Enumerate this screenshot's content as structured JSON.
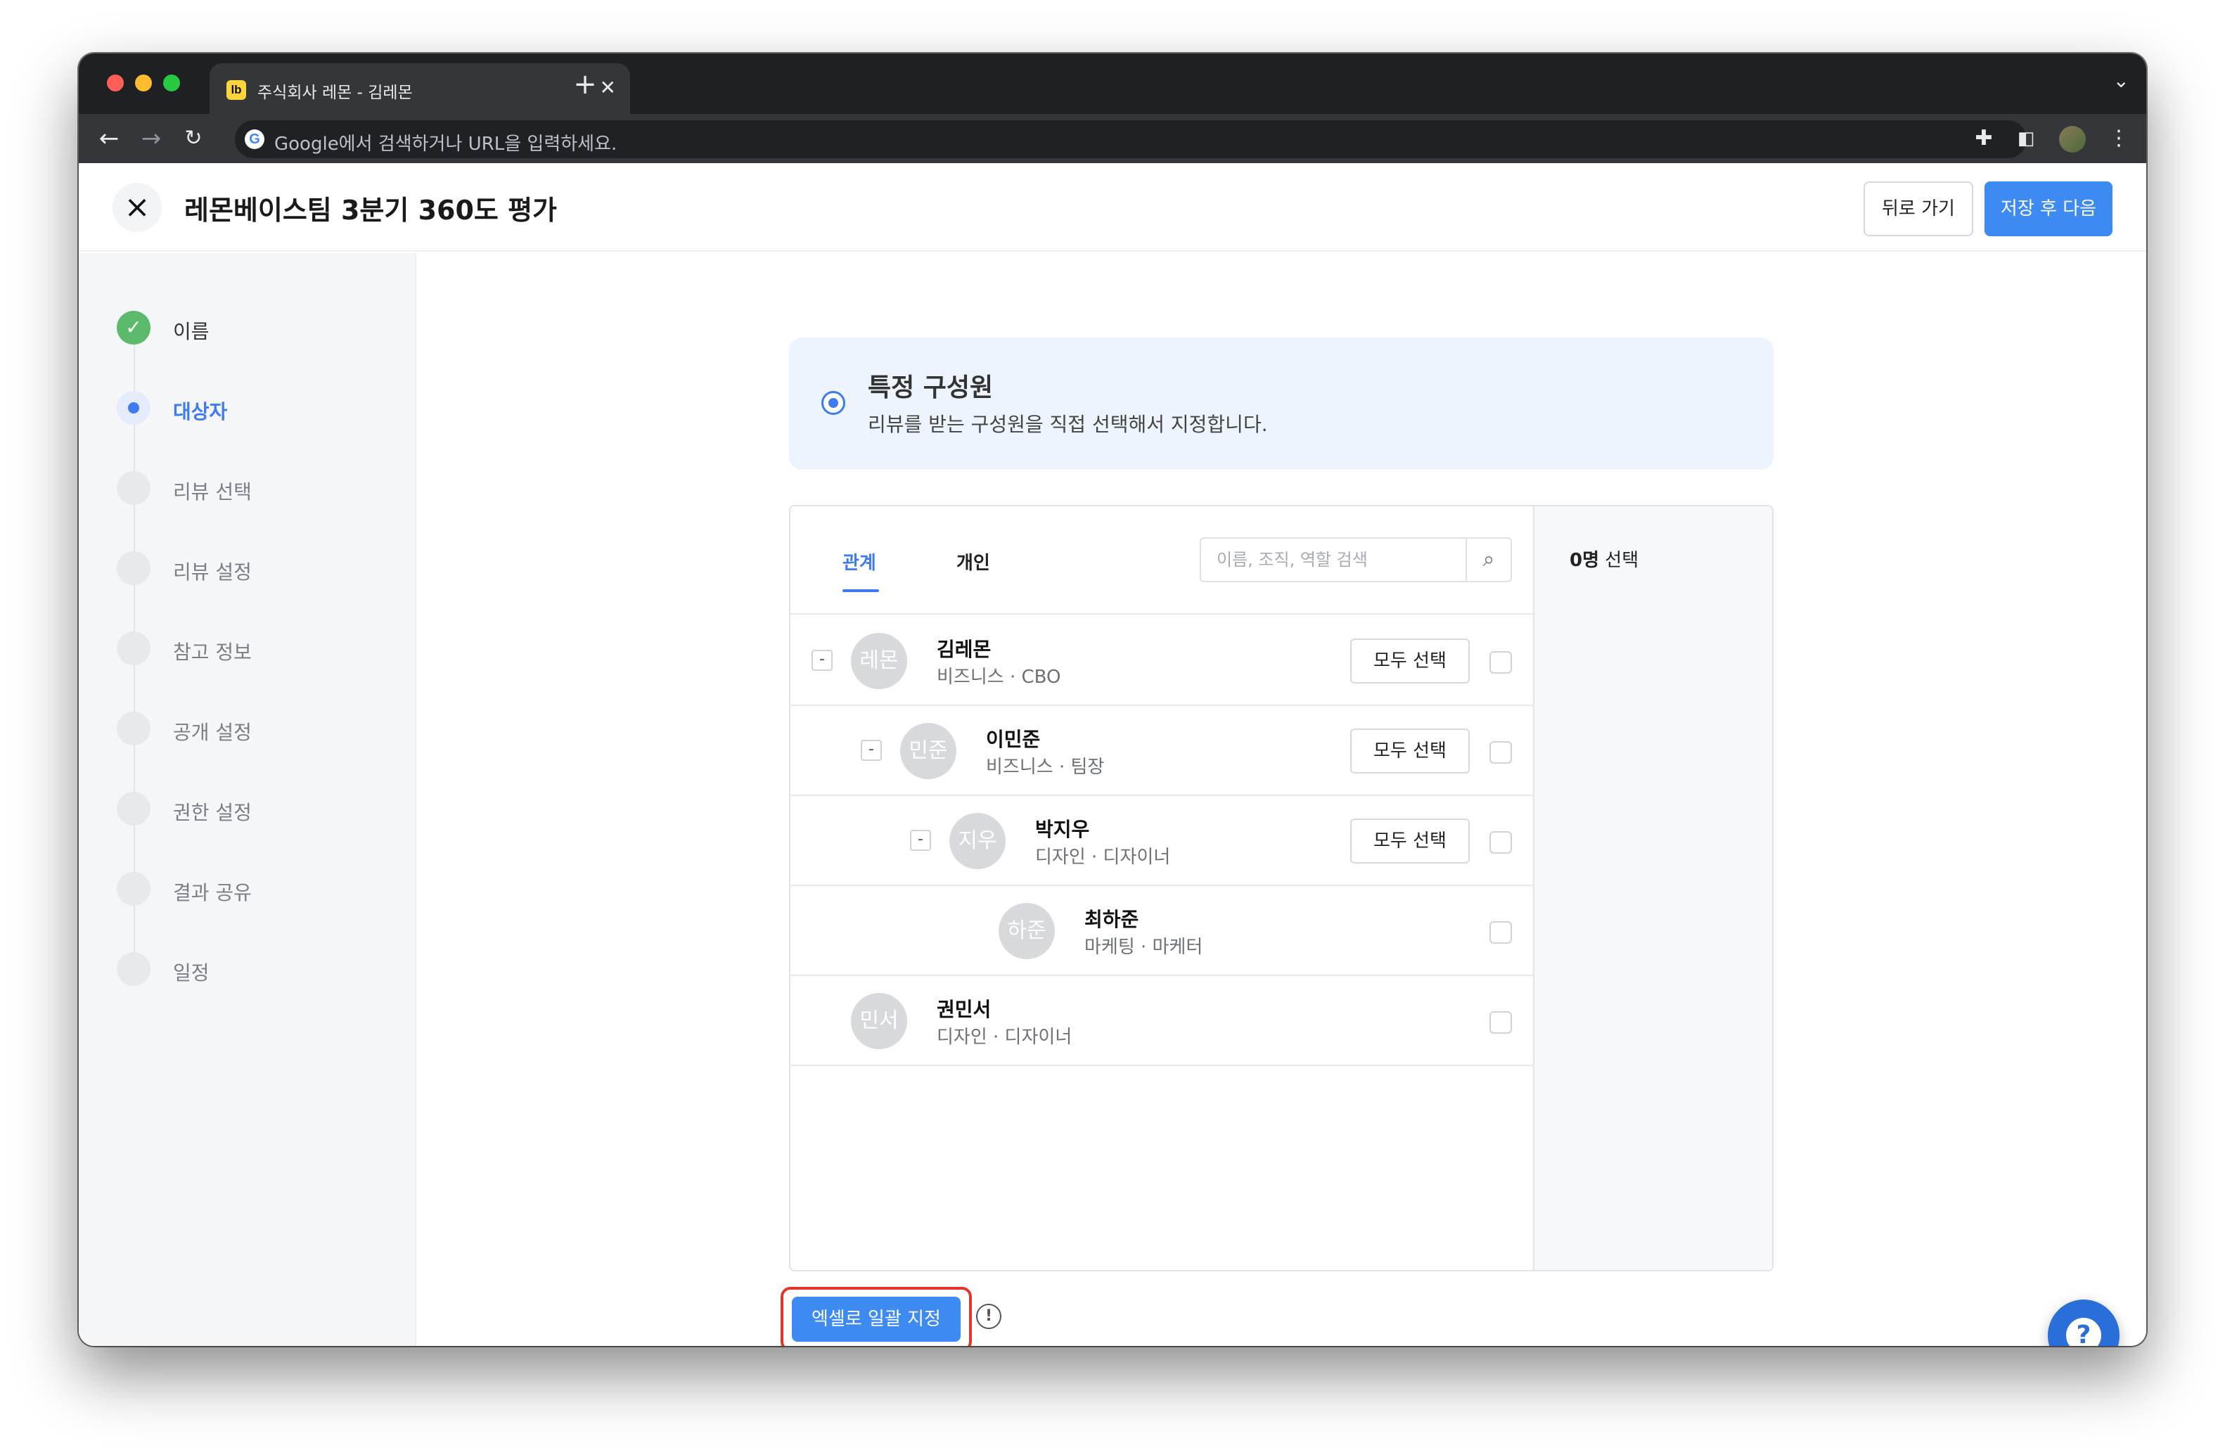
{
  "browser": {
    "tab_title": "주식회사 레몬 - 김레몬",
    "favicon_text": "lb",
    "new_tab_icon": "plus-icon",
    "omnibox_text": "Google에서 검색하거나 URL을 입력하세요."
  },
  "header": {
    "title": "레몬베이스팀 3분기 360도 평가",
    "back_label": "뒤로 가기",
    "save_label": "저장 후 다음"
  },
  "sidebar": {
    "steps": [
      {
        "label": "이름",
        "state": "done"
      },
      {
        "label": "대상자",
        "state": "active"
      },
      {
        "label": "리뷰 선택",
        "state": "pending"
      },
      {
        "label": "리뷰 설정",
        "state": "pending"
      },
      {
        "label": "참고 정보",
        "state": "pending"
      },
      {
        "label": "공개 설정",
        "state": "pending"
      },
      {
        "label": "권한 설정",
        "state": "pending"
      },
      {
        "label": "결과 공유",
        "state": "pending"
      },
      {
        "label": "일정",
        "state": "pending"
      }
    ]
  },
  "option": {
    "title": "특정 구성원",
    "description": "리뷰를 받는 구성원을 직접 선택해서 지정합니다."
  },
  "picker": {
    "tabs": [
      "관계",
      "개인"
    ],
    "search_placeholder": "이름, 조직, 역할 검색",
    "selected_count": "0명",
    "selected_suffix": "선택",
    "select_all_label": "모두 선택",
    "collapse_symbol": "-",
    "people": [
      {
        "avatar": "레몬",
        "name": "김레몬",
        "role": "비즈니스 · CBO"
      },
      {
        "avatar": "민준",
        "name": "이민준",
        "role": "비즈니스 · 팀장"
      },
      {
        "avatar": "지우",
        "name": "박지우",
        "role": "디자인 · 디자이너"
      },
      {
        "avatar": "하준",
        "name": "최하준",
        "role": "마케팅 · 마케터"
      },
      {
        "avatar": "민서",
        "name": "권민서",
        "role": "디자인 · 디자이너"
      }
    ]
  },
  "footer": {
    "excel_label": "엑셀로 일괄 지정",
    "info_symbol": "!",
    "help_symbol": "?"
  },
  "colors": {
    "accent": "#3d8bf2",
    "done": "#5bbb6a",
    "highlight": "#e5342b"
  }
}
